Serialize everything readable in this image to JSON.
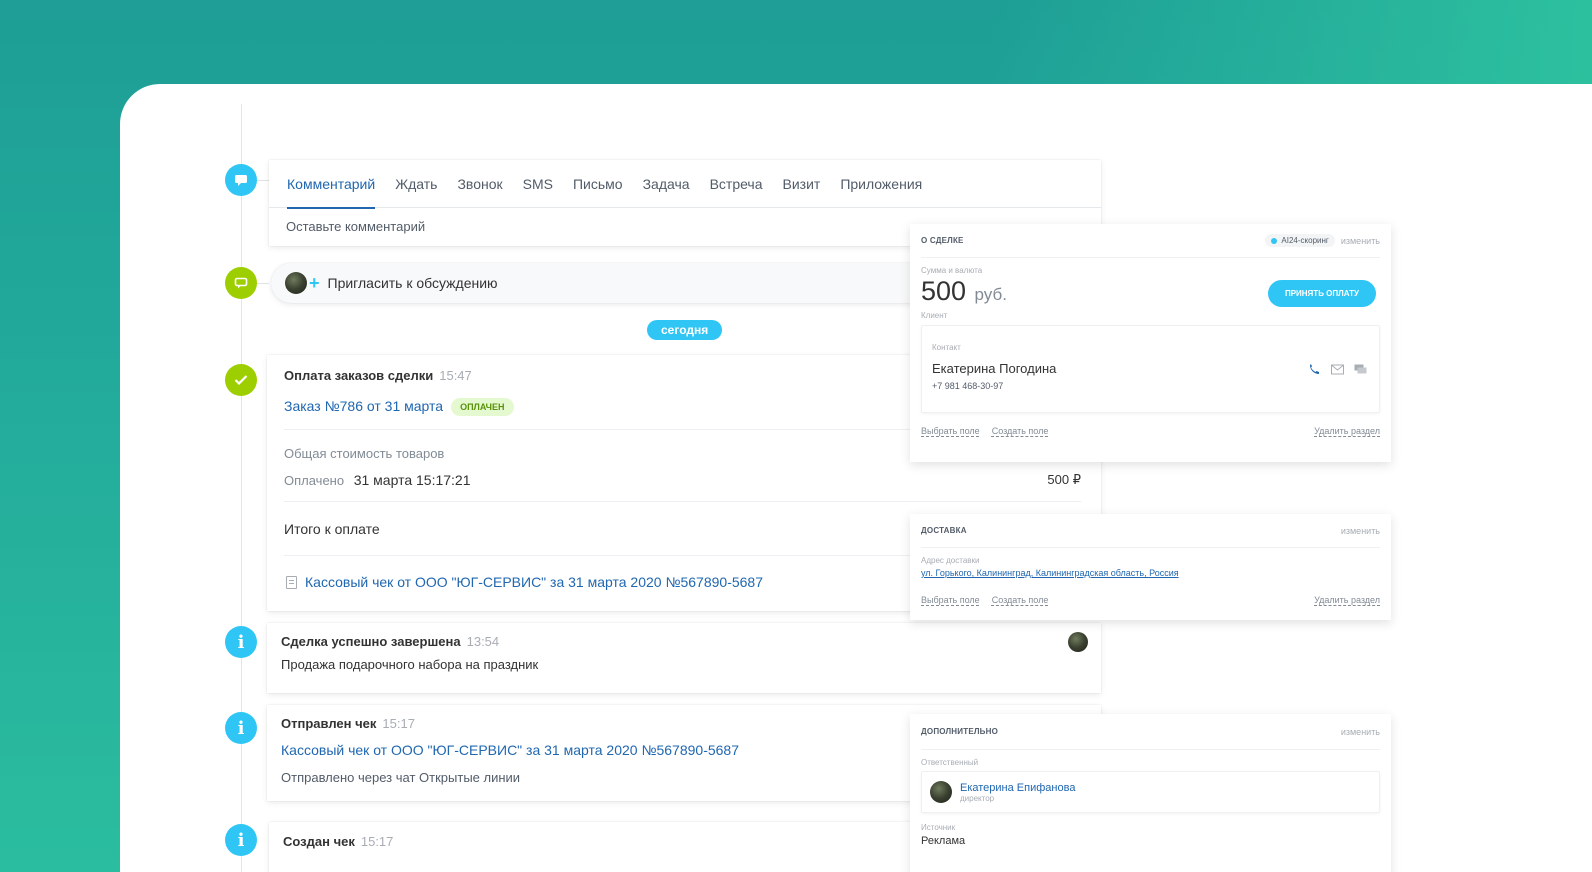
{
  "composer": {
    "tabs": [
      "Комментарий",
      "Ждать",
      "Звонок",
      "SMS",
      "Письмо",
      "Задача",
      "Встреча",
      "Визит",
      "Приложения"
    ],
    "placeholder": "Оставьте комментарий"
  },
  "invite": {
    "label": "Пригласить к обсуждению"
  },
  "today_label": "сегодня",
  "payment_event": {
    "title": "Оплата заказов сделки",
    "time": "15:47",
    "order_link": "Заказ №786 от 31 марта",
    "badge": "ОПЛАЧЕН",
    "total_label": "Общая стоимость товаров",
    "paid_label": "Оплачено",
    "paid_date": "31 марта 15:17:21",
    "paid_amount": "500 ₽",
    "due_label": "Итого к оплате",
    "receipt_link": "Кассовый чек от ООО \"ЮГ-СЕРВИС\" за 31 марта 2020 №567890-5687"
  },
  "deal_done": {
    "title": "Сделка успешно завершена",
    "time": "13:54",
    "text": "Продажа подарочного набора на праздник"
  },
  "receipt_sent": {
    "title": "Отправлен чек",
    "time": "15:17",
    "link": "Кассовый чек от ООО \"ЮГ-СЕРВИС\" за 31 марта 2020 №567890-5687",
    "text": "Отправлено через чат Открытые линии"
  },
  "receipt_created": {
    "title": "Создан чек",
    "time": "15:17"
  },
  "deal_card": {
    "title": "О СДЕЛКЕ",
    "ai_label": "AI24-скоринг",
    "edit": "изменить",
    "amount_label": "Сумма и валюта",
    "amount": "500",
    "currency": "руб.",
    "pay_button": "ПРИНЯТЬ ОПЛАТУ",
    "client_label": "Клиент",
    "contact_label": "Контакт",
    "contact_name": "Екатерина Погодина",
    "contact_phone": "+7 981 468-30-97",
    "select_field": "Выбрать поле",
    "create_field": "Создать поле",
    "delete_section": "Удалить раздел"
  },
  "delivery_card": {
    "title": "ДОСТАВКА",
    "edit": "изменить",
    "address_label": "Адрес доставки",
    "address": "ул. Горького, Калининград, Калининградская область, Россия",
    "select_field": "Выбрать поле",
    "create_field": "Создать поле",
    "delete_section": "Удалить раздел"
  },
  "extra_card": {
    "title": "ДОПОЛНИТЕЛЬНО",
    "edit": "изменить",
    "responsible_label": "Ответственный",
    "responsible_name": "Екатерина Епифанова",
    "responsible_role": "директор",
    "source_label": "Источник",
    "source_value": "Реклама"
  },
  "colors": {
    "accent": "#2fc6f6",
    "link": "#2067b0",
    "success": "#9dcf00"
  }
}
